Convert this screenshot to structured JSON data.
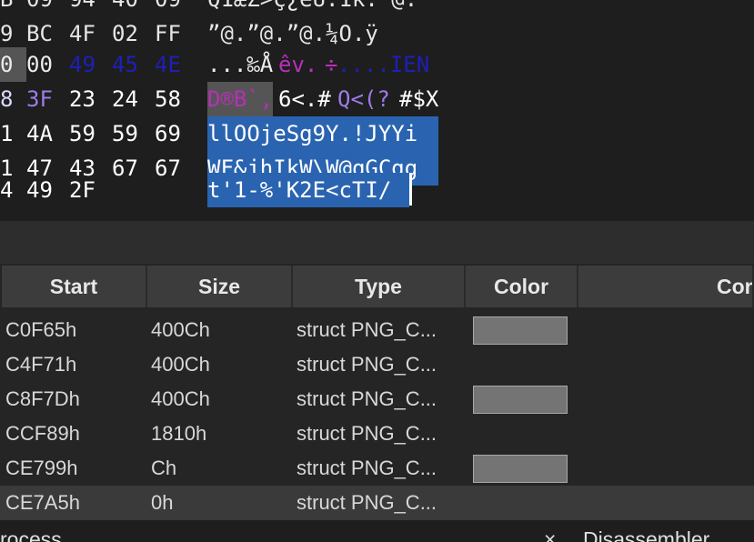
{
  "hex_editor": {
    "rows": [
      {
        "offset_tail": "B",
        "bytes": [
          "09",
          "94",
          "40",
          "09"
        ],
        "ascii": "Q1æZ>ç¿eU.1k. @."
      },
      {
        "offset_tail": "9",
        "bytes": [
          "BC",
          "4F",
          "02",
          "FF"
        ],
        "ascii": "”@.”@.”@.¼O.ÿ"
      },
      {
        "offset_tail": "0",
        "bytes": [
          "00",
          "49",
          "45",
          "4E"
        ],
        "ascii": [
          "...‰Å",
          "êv.",
          "÷",
          "....IEN"
        ]
      },
      {
        "offset_tail": "8",
        "bytes": [
          "3F",
          "23",
          "24",
          "58"
        ],
        "ascii": [
          "D®B`,",
          "6<.#",
          "Q<(?",
          "#$X"
        ]
      },
      {
        "offset_tail": "1",
        "bytes": [
          "4A",
          "59",
          "59",
          "69"
        ],
        "ascii": "llOOjeSg9Y.!JYYi"
      },
      {
        "offset_tail": "1",
        "bytes": [
          "47",
          "43",
          "67",
          "67"
        ],
        "ascii": "WF&jhIkW\\W@qGCgg"
      },
      {
        "offset_tail": "4",
        "bytes": [
          "49",
          "2F"
        ],
        "ascii": "t'1-%'K2E<cTI/"
      }
    ]
  },
  "segments_table": {
    "columns": [
      "Start",
      "Size",
      "Type",
      "Color",
      "Cor"
    ],
    "rows": [
      {
        "start": "C0F65h",
        "size": "400Ch",
        "type": "struct PNG_C...",
        "has_color": true
      },
      {
        "start": "C4F71h",
        "size": "400Ch",
        "type": "struct PNG_C...",
        "has_color": false
      },
      {
        "start": "C8F7Dh",
        "size": "400Ch",
        "type": "struct PNG_C...",
        "has_color": true
      },
      {
        "start": "CCF89h",
        "size": "1810h",
        "type": "struct PNG_C...",
        "has_color": false
      },
      {
        "start": "CE799h",
        "size": "Ch",
        "type": "struct PNG_C...",
        "has_color": true
      },
      {
        "start": "CE7A5h",
        "size": "0h",
        "type": "struct PNG_C...",
        "has_color": false
      }
    ],
    "swatch_color": "#747474",
    "selected_row_index": 5
  },
  "bottom_tabs": {
    "left_label": "rocess",
    "close_glyph": "×",
    "right_label": "Disassembler"
  }
}
